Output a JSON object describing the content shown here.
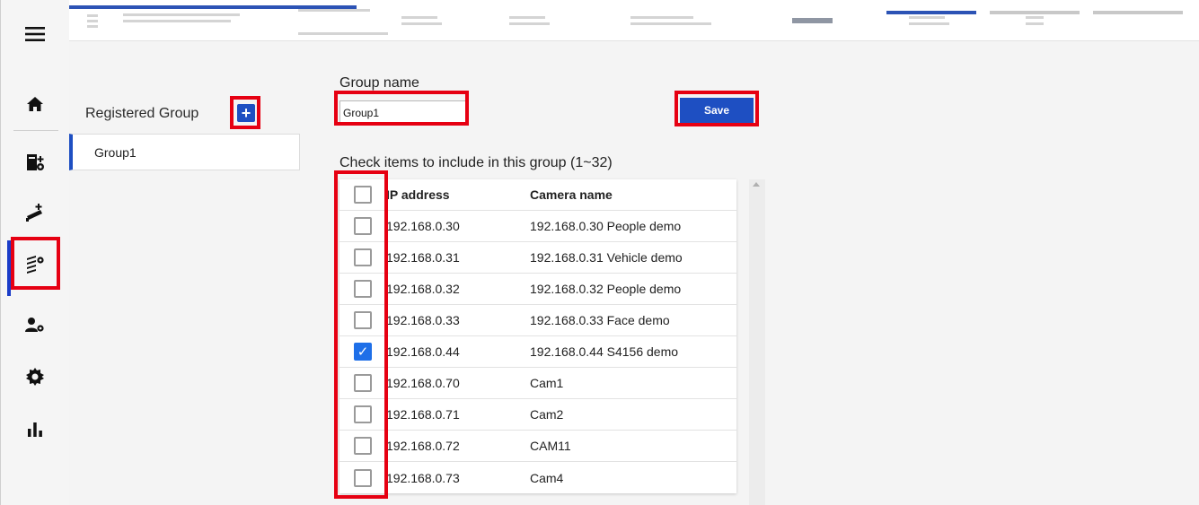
{
  "sidebar": {
    "items": [
      {
        "icon": "menu-icon"
      },
      {
        "icon": "home-icon"
      },
      {
        "icon": "server-settings-icon"
      },
      {
        "icon": "add-camera-icon"
      },
      {
        "icon": "group-settings-icon"
      },
      {
        "icon": "user-settings-icon"
      },
      {
        "icon": "gear-icon"
      },
      {
        "icon": "bar-chart-icon"
      }
    ]
  },
  "groups": {
    "title": "Registered Group",
    "add_label": "+",
    "items": [
      "Group1"
    ]
  },
  "form": {
    "group_name_label": "Group name",
    "group_name_value": "Group1",
    "save_label": "Save",
    "check_label": "Check items to include in this group (1~32)"
  },
  "table": {
    "headers": {
      "ip": "IP address",
      "name": "Camera name"
    },
    "rows": [
      {
        "ip": "192.168.0.30",
        "name": "192.168.0.30 People demo",
        "checked": false
      },
      {
        "ip": "192.168.0.31",
        "name": "192.168.0.31 Vehicle demo",
        "checked": false
      },
      {
        "ip": "192.168.0.32",
        "name": "192.168.0.32 People demo",
        "checked": false
      },
      {
        "ip": "192.168.0.33",
        "name": "192.168.0.33 Face demo",
        "checked": false
      },
      {
        "ip": "192.168.0.44",
        "name": "192.168.0.44 S4156 demo",
        "checked": true
      },
      {
        "ip": "192.168.0.70",
        "name": "Cam1",
        "checked": false
      },
      {
        "ip": "192.168.0.71",
        "name": "Cam2",
        "checked": false
      },
      {
        "ip": "192.168.0.72",
        "name": "CAM11",
        "checked": false
      },
      {
        "ip": "192.168.0.73",
        "name": "Cam4",
        "checked": false
      }
    ]
  },
  "colors": {
    "accent": "#1e4fc2",
    "highlight_box": "#e60012",
    "checkbox_checked": "#1e6fe8"
  }
}
